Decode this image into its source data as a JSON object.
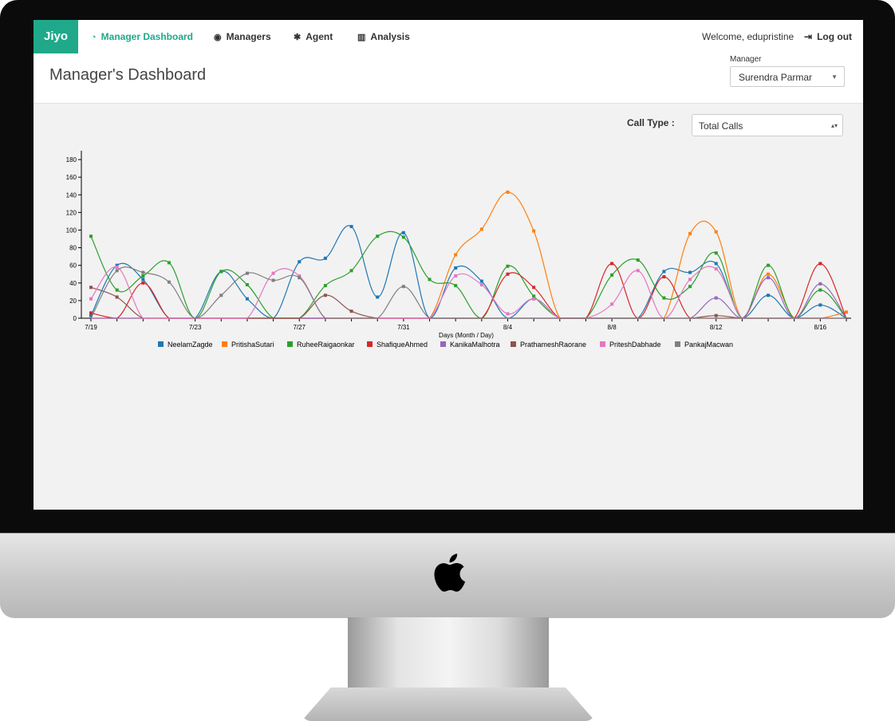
{
  "app": {
    "brand": "Jiyo",
    "nav": [
      {
        "label": "Manager Dashboard",
        "icon": "dashboard-icon",
        "active": true
      },
      {
        "label": "Managers",
        "icon": "user-circle-icon",
        "active": false
      },
      {
        "label": "Agent",
        "icon": "users-icon",
        "active": false
      },
      {
        "label": "Analysis",
        "icon": "bar-chart-icon",
        "active": false
      }
    ],
    "welcome": "Welcome, edupristine",
    "logout": "Log out"
  },
  "header": {
    "title": "Manager's Dashboard",
    "manager_label": "Manager",
    "manager_value": "Surendra Parmar"
  },
  "filters": {
    "call_type_label": "Call Type :",
    "call_type_value": "Total Calls"
  },
  "colors": {
    "accent": "#1fa98a"
  },
  "chart_data": {
    "type": "line",
    "xlabel": "Days (Month / Day)",
    "ylabel": "",
    "ylim": [
      0,
      190
    ],
    "yticks": [
      0,
      20,
      40,
      60,
      80,
      100,
      120,
      140,
      160,
      180
    ],
    "x": [
      "7/19",
      "7/20",
      "7/21",
      "7/22",
      "7/23",
      "7/24",
      "7/25",
      "7/26",
      "7/27",
      "7/28",
      "7/29",
      "7/30",
      "7/31",
      "8/1",
      "8/2",
      "8/3",
      "8/4",
      "8/5",
      "8/6",
      "8/7",
      "8/8",
      "8/9",
      "8/10",
      "8/11",
      "8/12",
      "8/13",
      "8/14",
      "8/15",
      "8/16",
      "8/17"
    ],
    "xtick_labels": [
      "7/19",
      "7/23",
      "7/27",
      "7/31",
      "8/4",
      "8/8",
      "8/12",
      "8/16"
    ],
    "legend_position": "bottom",
    "series": [
      {
        "name": "NeelamZagde",
        "color": "#1f77b4",
        "values": [
          3,
          60,
          44,
          0,
          0,
          53,
          22,
          0,
          64,
          68,
          104,
          24,
          97,
          0,
          57,
          42,
          0,
          22,
          0,
          0,
          0,
          0,
          53,
          52,
          62,
          0,
          26,
          0,
          15,
          0
        ]
      },
      {
        "name": "PritishaSutari",
        "color": "#ff7f0e",
        "values": [
          0,
          0,
          0,
          0,
          0,
          0,
          0,
          0,
          0,
          0,
          0,
          0,
          0,
          0,
          72,
          101,
          143,
          99,
          0,
          0,
          0,
          0,
          0,
          96,
          98,
          0,
          50,
          0,
          0,
          7
        ]
      },
      {
        "name": "RuheeRaigaonkar",
        "color": "#2ca02c",
        "values": [
          93,
          32,
          48,
          63,
          0,
          53,
          38,
          0,
          0,
          37,
          54,
          93,
          92,
          44,
          37,
          0,
          59,
          25,
          0,
          0,
          49,
          66,
          23,
          36,
          74,
          0,
          60,
          0,
          32,
          0
        ]
      },
      {
        "name": "ShafiqueAhmed",
        "color": "#d62728",
        "values": [
          6,
          0,
          40,
          0,
          0,
          0,
          0,
          0,
          0,
          0,
          0,
          0,
          0,
          0,
          0,
          0,
          50,
          35,
          0,
          0,
          62,
          0,
          47,
          0,
          0,
          0,
          0,
          0,
          62,
          0
        ]
      },
      {
        "name": "KanikaMalhotra",
        "color": "#9467bd",
        "values": [
          0,
          0,
          0,
          0,
          0,
          0,
          0,
          0,
          0,
          0,
          0,
          0,
          0,
          0,
          0,
          0,
          0,
          0,
          0,
          0,
          0,
          0,
          0,
          0,
          23,
          0,
          46,
          0,
          39,
          0
        ]
      },
      {
        "name": "PrathameshRaorane",
        "color": "#8c564b",
        "values": [
          35,
          24,
          0,
          0,
          0,
          0,
          0,
          0,
          0,
          26,
          8,
          0,
          0,
          0,
          0,
          0,
          0,
          0,
          0,
          0,
          0,
          0,
          0,
          0,
          3,
          0,
          0,
          0,
          0,
          0
        ]
      },
      {
        "name": "PriteshDabhade",
        "color": "#e377c2",
        "values": [
          22,
          58,
          0,
          0,
          0,
          0,
          0,
          51,
          48,
          0,
          0,
          0,
          0,
          0,
          48,
          38,
          5,
          22,
          0,
          0,
          16,
          54,
          0,
          44,
          56,
          0,
          0,
          0,
          0,
          0
        ]
      },
      {
        "name": "PankajMacwan",
        "color": "#7f7f7f",
        "values": [
          0,
          54,
          52,
          41,
          0,
          26,
          51,
          43,
          46,
          0,
          0,
          0,
          36,
          0,
          0,
          0,
          0,
          0,
          0,
          0,
          0,
          0,
          0,
          0,
          0,
          0,
          0,
          0,
          0,
          0
        ]
      }
    ]
  }
}
